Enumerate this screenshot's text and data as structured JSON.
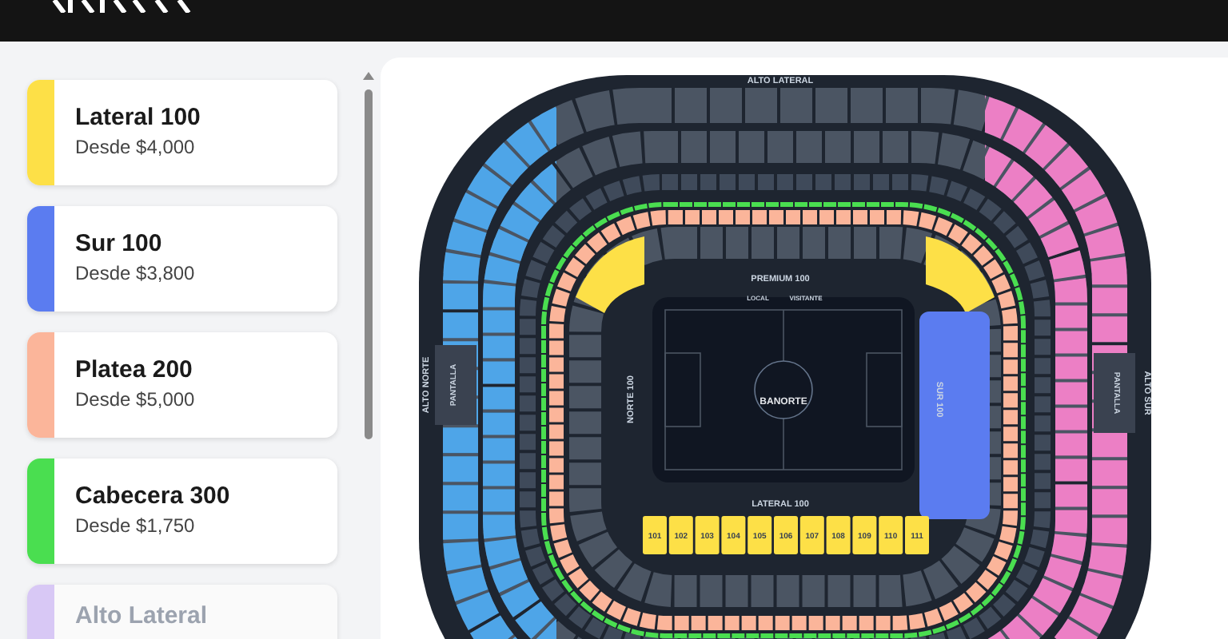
{
  "sidebar": {
    "items": [
      {
        "name": "Lateral 100",
        "price": "Desde $4,000",
        "color": "#fde047",
        "faded": false
      },
      {
        "name": "Sur 100",
        "price": "Desde $3,800",
        "color": "#5b7cf0",
        "faded": false
      },
      {
        "name": "Platea 200",
        "price": "Desde $5,000",
        "color": "#fbb59a",
        "faded": false
      },
      {
        "name": "Cabecera 300",
        "price": "Desde $1,750",
        "color": "#4ade50",
        "faded": false
      },
      {
        "name": "Alto Lateral",
        "color": "#d8c8f5",
        "faded": true
      }
    ]
  },
  "map": {
    "top_label": "ALTO LATERAL",
    "premium_label": "PREMIUM 100",
    "local_label": "LOCAL",
    "visitor_label": "VISITANTE",
    "lateral_label": "LATERAL 100",
    "north_label": "NORTE 100",
    "south_label": "SUR 100",
    "upper_north_label": "ALTO NORTE",
    "upper_south_label": "ALTO SUR",
    "screen_labels": [
      "PANTALLA",
      "PANTALLA"
    ],
    "stadium_logo": "BANORTE",
    "lateral_sections": [
      "101",
      "102",
      "103",
      "104",
      "105",
      "106",
      "107",
      "108",
      "109",
      "110",
      "111"
    ]
  }
}
